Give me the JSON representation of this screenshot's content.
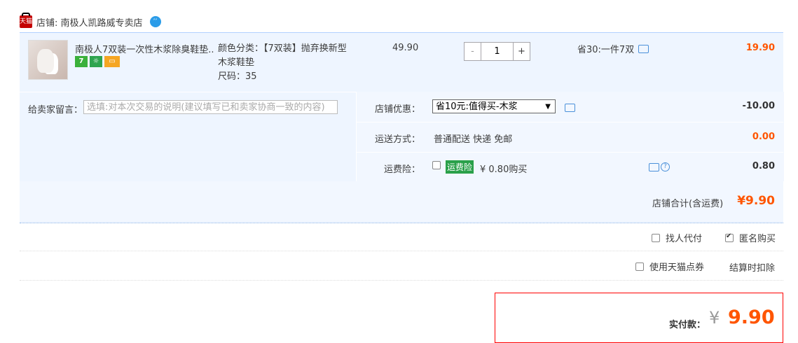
{
  "shop": {
    "logo_text": "天猫",
    "name": "店铺: 南极人凯路威专卖店",
    "ww_icon": "ww-chat-icon",
    "ww_glyph": "ʼʼ"
  },
  "item": {
    "title": "南极人7双装一次性木浆除臭鞋垫..",
    "badges": {
      "seven": "7",
      "hand": "☼",
      "card": "▭"
    },
    "sku_line1": "颜色分类：【7双装】抛弃换新型",
    "sku_line2": "木浆鞋垫",
    "sku_line3": "尺码：35",
    "price": "49.90",
    "qty_minus": "-",
    "quantity": "1",
    "qty_plus": "+",
    "promo": "省30:一件7双",
    "subtotal": "19.90"
  },
  "memo": {
    "label": "给卖家留言：",
    "placeholder": "选填:对本次交易的说明(建议填写已和卖家协商一致的内容)"
  },
  "discount": {
    "label": "店铺优惠：",
    "selected": "省10元:值得买-木浆",
    "caret": "▼",
    "amount": "-10.00"
  },
  "shipping": {
    "label": "运送方式：",
    "value": "普通配送 快递 免邮",
    "amount": "0.00"
  },
  "insurance": {
    "label": "运费险：",
    "badge": "运费险",
    "text": "¥ 0.80购买",
    "help": "?",
    "amount": "0.80"
  },
  "total": {
    "label": "店铺合计(含运费)",
    "amount": "¥9.90"
  },
  "options": {
    "proxy": "找人代付",
    "anonymous": "匿名购买",
    "tmall_points": "使用天猫点券",
    "deduct": "结算时扣除"
  },
  "payment": {
    "label": "实付款：",
    "yen": "¥",
    "amount": "9.90"
  },
  "colors": {
    "accent": "#ff5500",
    "border_blue": "#b2d1ff",
    "bg_blue": "#eef5ff"
  }
}
